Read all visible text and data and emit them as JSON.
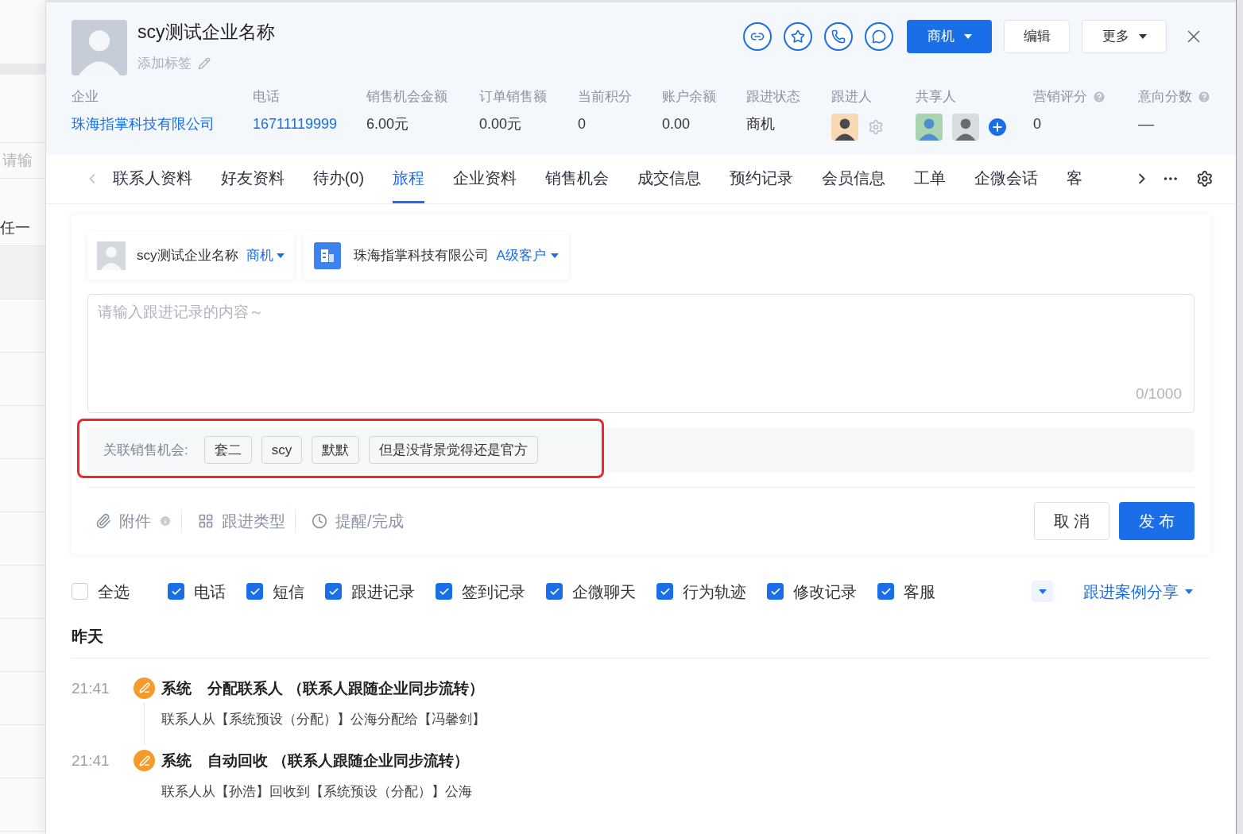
{
  "background_page": {
    "texts": [
      "请输",
      "任一"
    ]
  },
  "header": {
    "name": "scy测试企业名称",
    "tag_action": "添加标签",
    "icon_actions": [
      {
        "kind": "link"
      },
      {
        "kind": "star"
      },
      {
        "kind": "phone"
      },
      {
        "kind": "chat"
      }
    ],
    "primary_button": "商机",
    "edit_button": "编辑",
    "more_button": "更多"
  },
  "fields": [
    {
      "label": "企业",
      "kind": "link",
      "value": "珠海指掌科技有限公司"
    },
    {
      "label": "电话",
      "kind": "link",
      "value": "16711119999"
    },
    {
      "label": "销售机会金额",
      "kind": "text",
      "value": "6.00元"
    },
    {
      "label": "订单销售额",
      "kind": "text",
      "value": "0.00元"
    },
    {
      "label": "当前积分",
      "kind": "text",
      "value": "0"
    },
    {
      "label": "账户余额",
      "kind": "text",
      "value": "0.00"
    },
    {
      "label": "跟进状态",
      "kind": "text",
      "value": "商机"
    },
    {
      "label": "跟进人",
      "kind": "owner"
    },
    {
      "label": "共享人",
      "kind": "shared"
    },
    {
      "label": "营销评分",
      "kind": "text",
      "value": "0",
      "help": true
    },
    {
      "label": "意向分数",
      "kind": "text",
      "value": "––",
      "help": true
    }
  ],
  "tabs": [
    {
      "label": "联系人资料",
      "selected": false
    },
    {
      "label": "好友资料",
      "selected": false
    },
    {
      "label": "待办(0)",
      "selected": false
    },
    {
      "label": "旅程",
      "selected": true
    },
    {
      "label": "企业资料",
      "selected": false
    },
    {
      "label": "销售机会",
      "selected": false
    },
    {
      "label": "成交信息",
      "selected": false
    },
    {
      "label": "预约记录",
      "selected": false
    },
    {
      "label": "会员信息",
      "selected": false
    },
    {
      "label": "工单",
      "selected": false
    },
    {
      "label": "企微会话",
      "selected": false
    },
    {
      "label": "客",
      "selected": false
    }
  ],
  "composer": {
    "contact": {
      "name": "scy测试企业名称",
      "status": "商机"
    },
    "company": {
      "name": "珠海指掌科技有限公司",
      "grade": "A级客户"
    },
    "placeholder": "请输入跟进记录的内容～",
    "counter": "0/1000",
    "linked_label": "关联销售机会:",
    "linked_tags": [
      "套二",
      "scy",
      "默默",
      "但是没背景觉得还是官方"
    ],
    "tools": [
      {
        "kind": "attachment",
        "label": "附件",
        "info": true
      },
      {
        "kind": "type",
        "label": "跟进类型",
        "info": false
      },
      {
        "kind": "reminder",
        "label": "提醒/完成",
        "info": false
      }
    ],
    "cancel_button": "取 消",
    "publish_button": "发 布"
  },
  "filters": [
    {
      "label": "全选",
      "checked": false
    },
    {
      "label": "电话",
      "checked": true
    },
    {
      "label": "短信",
      "checked": true
    },
    {
      "label": "跟进记录",
      "checked": true
    },
    {
      "label": "签到记录",
      "checked": true
    },
    {
      "label": "企微聊天",
      "checked": true
    },
    {
      "label": "行为轨迹",
      "checked": true
    },
    {
      "label": "修改记录",
      "checked": true
    },
    {
      "label": "客服",
      "checked": true
    }
  ],
  "share_menu": "跟进案例分享",
  "timeline": {
    "date": "昨天",
    "entries": [
      {
        "time": "21:41",
        "actor": "系统",
        "title": "分配联系人",
        "note": "（联系人跟随企业同步流转）",
        "detail": "联系人从【系统预设（分配）】公海分配给【冯馨剑】"
      },
      {
        "time": "21:41",
        "actor": "系统",
        "title": "自动回收",
        "note": "（联系人跟随企业同步流转）",
        "detail": "联系人从【孙浩】回收到【系统预设（分配）】公海"
      }
    ]
  }
}
